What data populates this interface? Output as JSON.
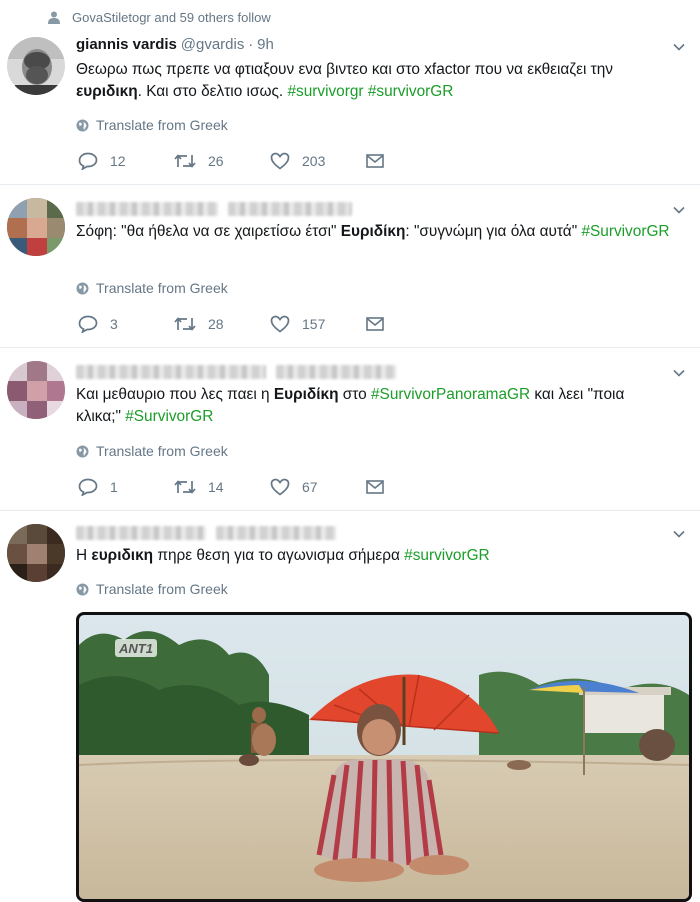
{
  "social_context": "GovaStiletogr and 59 others follow",
  "tweets": [
    {
      "name": "giannis vardis",
      "handle": "@gvardis",
      "sep": "·",
      "time": "9h",
      "text_parts": [
        "Θεωρω πως πρεπε να φτιαξουν ενα βιντεο και στο xfactor που να εκθειαζει την ",
        "ευριδικη",
        ". Και στο δελτιο ισως. ",
        "#survivorgr",
        " ",
        "#survivorGR"
      ],
      "translate": "Translate from Greek",
      "replies": "12",
      "retweets": "26",
      "likes": "203"
    },
    {
      "text_parts": [
        "Σόφη: \"θα ήθελα να σε χαιρετίσω έτσι\" ",
        "Ευριδίκη",
        ": \"συγνώμη για όλα αυτά\" ",
        "#SurvivorGR"
      ],
      "translate": "Translate from Greek",
      "replies": "3",
      "retweets": "28",
      "likes": "157"
    },
    {
      "text_parts": [
        "Και μεθαυριο που λες παει η ",
        "Ευριδίκη",
        " στο ",
        "#SurvivorPanoramaGR",
        " και λεει \"ποια κλικα;\" ",
        "#SurvivorGR"
      ],
      "translate": "Translate from Greek",
      "replies": "1",
      "retweets": "14",
      "likes": "67"
    },
    {
      "text_parts": [
        "Η ",
        "ευριδικη",
        " πηρε θεση για το αγωνισμα σήμερα ",
        "#survivorGR"
      ],
      "translate": "Translate from Greek",
      "media_logo": "ANT1"
    }
  ],
  "colors": {
    "hashtag": "#1b9d29",
    "secondary": "#657786",
    "divider": "#e6ecf0"
  },
  "icons": [
    "person-icon",
    "chevron-down-icon",
    "globe-icon",
    "reply-icon",
    "retweet-icon",
    "like-icon",
    "direct-message-icon"
  ]
}
